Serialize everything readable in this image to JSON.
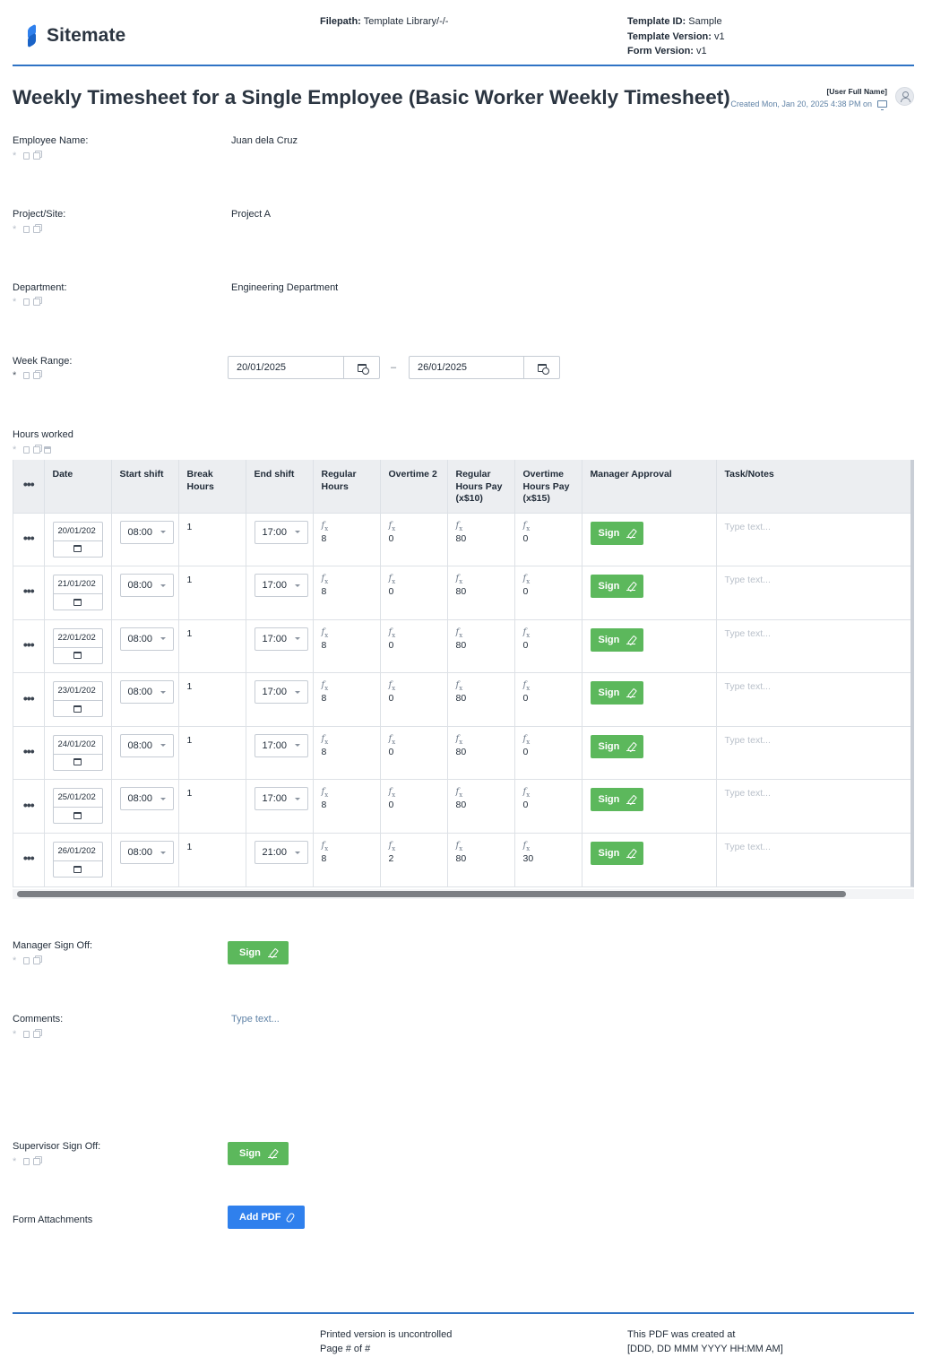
{
  "header": {
    "logo_text": "Sitemate",
    "filepath_label": "Filepath:",
    "filepath_value": "Template Library/-/-",
    "template_id_label": "Template ID:",
    "template_id_value": "Sample",
    "template_version_label": "Template Version:",
    "template_version_value": "v1",
    "form_version_label": "Form Version:",
    "form_version_value": "v1"
  },
  "title": "Weekly Timesheet for a Single Employee (Basic Worker Weekly Timesheet)",
  "creator": {
    "user_name": "[User Full Name]",
    "created_text": "Created Mon, Jan 20, 2025 4:38 PM on"
  },
  "fields": {
    "employee_name": {
      "label": "Employee Name:",
      "value": "Juan dela Cruz"
    },
    "project_site": {
      "label": "Project/Site:",
      "value": "Project A"
    },
    "department": {
      "label": "Department:",
      "value": "Engineering Department"
    },
    "week_range": {
      "label": "Week Range:",
      "start": "20/01/2025",
      "end": "26/01/2025",
      "separator": "–"
    },
    "hours_worked": {
      "label": "Hours worked"
    },
    "manager_sign_off": {
      "label": "Manager Sign Off:",
      "button": "Sign"
    },
    "comments": {
      "label": "Comments:",
      "placeholder": "Type text..."
    },
    "supervisor_sign_off": {
      "label": "Supervisor Sign Off:",
      "button": "Sign"
    },
    "form_attachments": {
      "label": "Form Attachments",
      "button": "Add PDF"
    }
  },
  "table": {
    "columns": [
      "Date",
      "Start shift",
      "Break Hours",
      "End shift",
      "Regular Hours",
      "Overtime 2",
      "Regular Hours Pay (x$10)",
      "Overtime Hours Pay (x$15)",
      "Manager Approval",
      "Task/Notes"
    ],
    "rows": [
      {
        "date": "20/01/202",
        "start": "08:00",
        "break": "1",
        "end": "17:00",
        "regular": "8",
        "overtime": "0",
        "reg_pay": "80",
        "ot_pay": "0",
        "approval": "Sign",
        "notes": "Type text..."
      },
      {
        "date": "21/01/202",
        "start": "08:00",
        "break": "1",
        "end": "17:00",
        "regular": "8",
        "overtime": "0",
        "reg_pay": "80",
        "ot_pay": "0",
        "approval": "Sign",
        "notes": "Type text..."
      },
      {
        "date": "22/01/202",
        "start": "08:00",
        "break": "1",
        "end": "17:00",
        "regular": "8",
        "overtime": "0",
        "reg_pay": "80",
        "ot_pay": "0",
        "approval": "Sign",
        "notes": "Type text..."
      },
      {
        "date": "23/01/202",
        "start": "08:00",
        "break": "1",
        "end": "17:00",
        "regular": "8",
        "overtime": "0",
        "reg_pay": "80",
        "ot_pay": "0",
        "approval": "Sign",
        "notes": "Type text..."
      },
      {
        "date": "24/01/202",
        "start": "08:00",
        "break": "1",
        "end": "17:00",
        "regular": "8",
        "overtime": "0",
        "reg_pay": "80",
        "ot_pay": "0",
        "approval": "Sign",
        "notes": "Type text..."
      },
      {
        "date": "25/01/202",
        "start": "08:00",
        "break": "1",
        "end": "17:00",
        "regular": "8",
        "overtime": "0",
        "reg_pay": "80",
        "ot_pay": "0",
        "approval": "Sign",
        "notes": "Type text..."
      },
      {
        "date": "26/01/202",
        "start": "08:00",
        "break": "1",
        "end": "21:00",
        "regular": "8",
        "overtime": "2",
        "reg_pay": "80",
        "ot_pay": "30",
        "approval": "Sign",
        "notes": "Type text..."
      }
    ]
  },
  "footer": {
    "left_line1": "Printed version is uncontrolled",
    "left_line2": "Page # of #",
    "right_line1": "This PDF was created at",
    "right_line2": "[DDD, DD MMM YYYY HH:MM AM]"
  },
  "colors": {
    "accent": "#2f73c5",
    "sign_green": "#5cb85c",
    "add_pdf_blue": "#2f80ed",
    "muted_link": "#5f82a6"
  },
  "icons": [
    "calendar-icon",
    "calendar-clock-icon",
    "pen-icon",
    "paperclip-icon",
    "monitor-icon",
    "user-icon",
    "formula-icon",
    "more-dots-icon",
    "required-asterisk-icon",
    "document-icon",
    "copy-icon"
  ]
}
